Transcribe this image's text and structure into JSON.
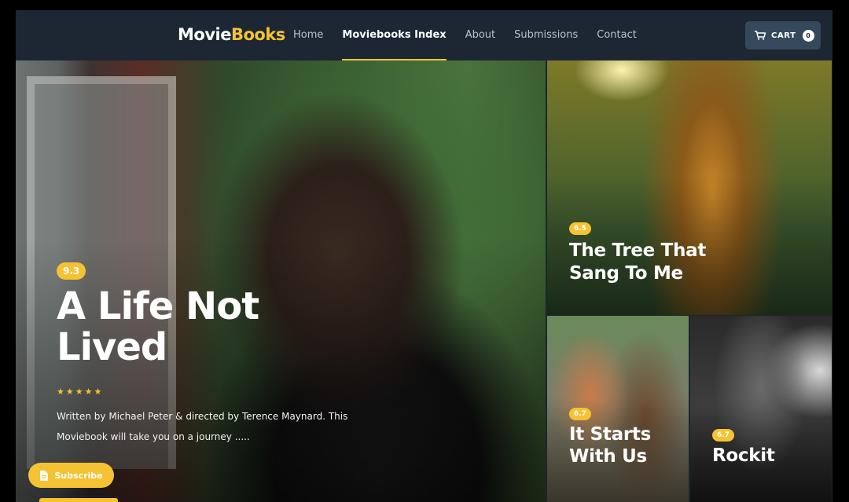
{
  "header": {
    "logo_part1": "Movie",
    "logo_part2": "Books",
    "nav": [
      {
        "label": "Home",
        "active": false
      },
      {
        "label": "Moviebooks Index",
        "active": true
      },
      {
        "label": "About",
        "active": false
      },
      {
        "label": "Submissions",
        "active": false
      },
      {
        "label": "Contact",
        "active": false
      }
    ],
    "cart": {
      "label": "CART",
      "count": "0",
      "icon": "cart-icon"
    }
  },
  "featured": {
    "rating": "9.3",
    "title_line1": "A Life Not",
    "title_line2": "Lived",
    "stars": "★★★★★",
    "star_rating": 5,
    "description_line1": "Written by Michael Peter & directed by Terence Maynard. This",
    "description_line2": "Moviebook will take you on a journey .....",
    "subscribe_label": "Subscribe",
    "subscribe_icon": "document-icon"
  },
  "tiles": [
    {
      "rating": "6.5",
      "title_line1": "The Tree That",
      "title_line2": "Sang To Me"
    },
    {
      "rating": "6.7",
      "title_line1": "It Starts",
      "title_line2": "With Us"
    },
    {
      "rating": "6.7",
      "title_line1": "Rockit",
      "title_line2": ""
    }
  ],
  "colors": {
    "accent": "#f5c233",
    "header_bg": "#1c2733",
    "cart_bg": "#34495c"
  }
}
